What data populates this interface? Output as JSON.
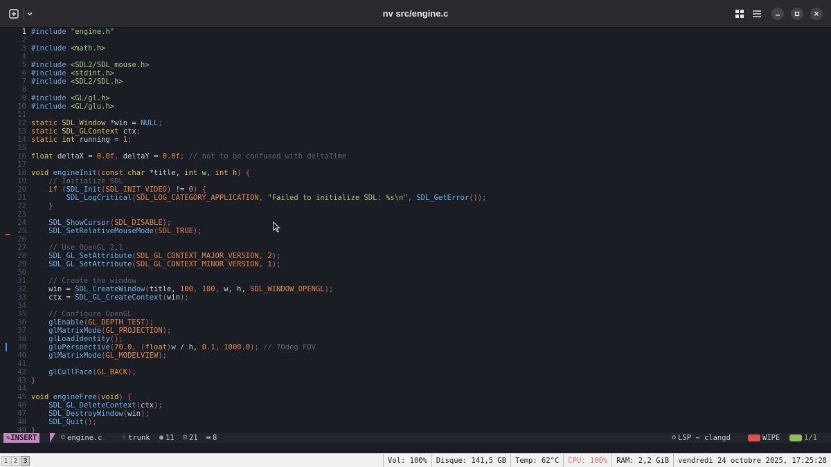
{
  "window": {
    "title": "nv src/engine.c"
  },
  "editor": {
    "lines": [
      {
        "n": "1",
        "segs": [
          [
            "pp",
            "#include "
          ],
          [
            "str",
            "\"engine.h\""
          ]
        ]
      },
      {
        "n": "2",
        "segs": []
      },
      {
        "n": "3",
        "segs": [
          [
            "pp",
            "#include "
          ],
          [
            "str",
            "<math.h>"
          ]
        ]
      },
      {
        "n": "4",
        "segs": []
      },
      {
        "n": "5",
        "segs": [
          [
            "pp",
            "#include "
          ],
          [
            "str",
            "<SDL2/SDL_mouse.h>"
          ]
        ]
      },
      {
        "n": "6",
        "segs": [
          [
            "pp",
            "#include "
          ],
          [
            "str",
            "<stdint.h>"
          ]
        ]
      },
      {
        "n": "7",
        "segs": [
          [
            "pp",
            "#include "
          ],
          [
            "str",
            "<SDL2/SDL.h>"
          ]
        ]
      },
      {
        "n": "8",
        "segs": []
      },
      {
        "n": "9",
        "segs": [
          [
            "pp",
            "#include "
          ],
          [
            "str",
            "<GL/gl.h>"
          ]
        ]
      },
      {
        "n": "10",
        "segs": [
          [
            "pp",
            "#include "
          ],
          [
            "str",
            "<GL/glu.h>"
          ]
        ]
      },
      {
        "n": "11",
        "segs": []
      },
      {
        "n": "12",
        "segs": [
          [
            "kw",
            "static "
          ],
          [
            "ty",
            "SDL_Window "
          ],
          [
            "op",
            "*win = "
          ],
          [
            "nul",
            "NULL"
          ],
          [
            "pun",
            ";"
          ]
        ]
      },
      {
        "n": "13",
        "segs": [
          [
            "kw",
            "static "
          ],
          [
            "ty",
            "SDL_GLContext "
          ],
          [
            "id",
            "ctx"
          ],
          [
            "pun",
            ";"
          ]
        ]
      },
      {
        "n": "14",
        "segs": [
          [
            "kw",
            "static "
          ],
          [
            "ty",
            "int "
          ],
          [
            "id",
            "running = "
          ],
          [
            "num",
            "1"
          ],
          [
            "pun",
            ";"
          ]
        ]
      },
      {
        "n": "15",
        "segs": []
      },
      {
        "n": "16",
        "segs": [
          [
            "ty",
            "float "
          ],
          [
            "id",
            "deltaX = "
          ],
          [
            "num",
            "0.0f"
          ],
          [
            "pun",
            ", "
          ],
          [
            "id",
            "deltaY = "
          ],
          [
            "num",
            "0.0f"
          ],
          [
            "pun",
            "; "
          ],
          [
            "cm",
            "// not to be confused with deltaTime"
          ]
        ]
      },
      {
        "n": "17",
        "segs": []
      },
      {
        "n": "18",
        "segs": [
          [
            "ty",
            "void "
          ],
          [
            "fn",
            "engineInit"
          ],
          [
            "pun",
            "("
          ],
          [
            "kw",
            "const "
          ],
          [
            "ty",
            "char "
          ],
          [
            "op",
            "*title, "
          ],
          [
            "ty",
            "int "
          ],
          [
            "id",
            "w, "
          ],
          [
            "ty",
            "int "
          ],
          [
            "id",
            "h"
          ],
          [
            "pun",
            ") {"
          ]
        ]
      },
      {
        "n": "19",
        "segs": [
          [
            "cm",
            "    // Initialize SDL"
          ]
        ]
      },
      {
        "n": "20",
        "segs": [
          [
            "kw",
            "    if "
          ],
          [
            "pun",
            "("
          ],
          [
            "fn",
            "SDL_Init"
          ],
          [
            "pun",
            "("
          ],
          [
            "mac",
            "SDL_INIT_VIDEO"
          ],
          [
            "pun",
            ") "
          ],
          [
            "op",
            "!= "
          ],
          [
            "num",
            "0"
          ],
          [
            "pun",
            ") {"
          ]
        ]
      },
      {
        "n": "21",
        "segs": [
          [
            "fn",
            "        SDL_LogCritical"
          ],
          [
            "pun",
            "("
          ],
          [
            "mac",
            "SDL_LOG_CATEGORY_APPLICATION"
          ],
          [
            "pun",
            ", "
          ],
          [
            "str",
            "\"Failed to initialize SDL: %s\\n\""
          ],
          [
            "pun",
            ", "
          ],
          [
            "fn",
            "SDL_GetError"
          ],
          [
            "pun",
            "());"
          ]
        ]
      },
      {
        "n": "22",
        "segs": [
          [
            "pun",
            "    }"
          ]
        ]
      },
      {
        "n": "23",
        "segs": []
      },
      {
        "n": "24",
        "segs": [
          [
            "fn",
            "    SDL_ShowCursor"
          ],
          [
            "pun",
            "("
          ],
          [
            "mac",
            "SDL_DISABLE"
          ],
          [
            "pun",
            ");"
          ]
        ]
      },
      {
        "n": "25",
        "segs": [
          [
            "fn",
            "    SDL_SetRelativeMouseMode"
          ],
          [
            "pun",
            "("
          ],
          [
            "mac",
            "SDL_TRUE"
          ],
          [
            "pun",
            ");"
          ]
        ],
        "sign": "red"
      },
      {
        "n": "26",
        "segs": []
      },
      {
        "n": "27",
        "segs": [
          [
            "cm",
            "    // Use OpenGL 2.1"
          ]
        ]
      },
      {
        "n": "28",
        "segs": [
          [
            "fn",
            "    SDL_GL_SetAttribute"
          ],
          [
            "pun",
            "("
          ],
          [
            "mac",
            "SDL_GL_CONTEXT_MAJOR_VERSION"
          ],
          [
            "pun",
            ", "
          ],
          [
            "num",
            "2"
          ],
          [
            "pun",
            ");"
          ]
        ]
      },
      {
        "n": "29",
        "segs": [
          [
            "fn",
            "    SDL_GL_SetAttribute"
          ],
          [
            "pun",
            "("
          ],
          [
            "mac",
            "SDL_GL_CONTEXT_MINOR_VERSION"
          ],
          [
            "pun",
            ", "
          ],
          [
            "num",
            "1"
          ],
          [
            "pun",
            ");"
          ]
        ]
      },
      {
        "n": "30",
        "segs": []
      },
      {
        "n": "31",
        "segs": [
          [
            "cm",
            "    // Create the window"
          ]
        ]
      },
      {
        "n": "32",
        "segs": [
          [
            "id",
            "    win = "
          ],
          [
            "fn",
            "SDL_CreateWindow"
          ],
          [
            "pun",
            "("
          ],
          [
            "id",
            "title, "
          ],
          [
            "num",
            "100"
          ],
          [
            "pun",
            ", "
          ],
          [
            "num",
            "100"
          ],
          [
            "pun",
            ", "
          ],
          [
            "id",
            "w, h, "
          ],
          [
            "mac",
            "SDL_WINDOW_OPENGL"
          ],
          [
            "pun",
            ");"
          ]
        ]
      },
      {
        "n": "33",
        "segs": [
          [
            "id",
            "    ctx = "
          ],
          [
            "fn",
            "SDL_GL_CreateContext"
          ],
          [
            "pun",
            "("
          ],
          [
            "id",
            "win"
          ],
          [
            "pun",
            ");"
          ]
        ]
      },
      {
        "n": "34",
        "segs": []
      },
      {
        "n": "35",
        "segs": [
          [
            "cm",
            "    // Configure OpenGL"
          ]
        ]
      },
      {
        "n": "36",
        "segs": [
          [
            "fn",
            "    glEnable"
          ],
          [
            "pun",
            "("
          ],
          [
            "mac",
            "GL_DEPTH_TEST"
          ],
          [
            "pun",
            ");"
          ]
        ]
      },
      {
        "n": "37",
        "segs": [
          [
            "fn",
            "    glMatrixMode"
          ],
          [
            "pun",
            "("
          ],
          [
            "mac",
            "GL_PROJECTION"
          ],
          [
            "pun",
            ");"
          ]
        ]
      },
      {
        "n": "38",
        "segs": [
          [
            "fn",
            "    glLoadIdentity"
          ],
          [
            "pun",
            "();"
          ]
        ]
      },
      {
        "n": "39",
        "segs": [
          [
            "fn",
            "    gluPerspective"
          ],
          [
            "pun",
            "("
          ],
          [
            "num",
            "70.0"
          ],
          [
            "pun",
            ", ("
          ],
          [
            "kw",
            "float"
          ],
          [
            "pun",
            ")"
          ],
          [
            "id",
            "w / h, "
          ],
          [
            "num",
            "0.1"
          ],
          [
            "pun",
            ", "
          ],
          [
            "num",
            "1000.0"
          ],
          [
            "pun",
            "); "
          ],
          [
            "cm",
            "// 70deg FOV"
          ]
        ],
        "sign": "blue"
      },
      {
        "n": "40",
        "segs": [
          [
            "fn",
            "    glMatrixMode"
          ],
          [
            "pun",
            "("
          ],
          [
            "mac",
            "GL_MODELVIEW"
          ],
          [
            "pun",
            ");"
          ]
        ]
      },
      {
        "n": "41",
        "segs": []
      },
      {
        "n": "42",
        "segs": [
          [
            "fn",
            "    glCullFace"
          ],
          [
            "pun",
            "("
          ],
          [
            "mac",
            "GL_BACK"
          ],
          [
            "pun",
            ");"
          ]
        ]
      },
      {
        "n": "43",
        "segs": [
          [
            "pun",
            "}"
          ]
        ]
      },
      {
        "n": "44",
        "segs": []
      },
      {
        "n": "45",
        "segs": [
          [
            "ty",
            "void "
          ],
          [
            "fn",
            "engineFree"
          ],
          [
            "pun",
            "("
          ],
          [
            "ty",
            "void"
          ],
          [
            "pun",
            ") {"
          ]
        ]
      },
      {
        "n": "46",
        "segs": [
          [
            "fn",
            "    SDL_GL_DeleteContext"
          ],
          [
            "pun",
            "("
          ],
          [
            "id",
            "ctx"
          ],
          [
            "pun",
            ");"
          ]
        ]
      },
      {
        "n": "47",
        "segs": [
          [
            "fn",
            "    SDL_DestroyWindow"
          ],
          [
            "pun",
            "("
          ],
          [
            "id",
            "win"
          ],
          [
            "pun",
            ");"
          ]
        ]
      },
      {
        "n": "48",
        "segs": [
          [
            "fn",
            "    SDL_Quit"
          ],
          [
            "pun",
            "();"
          ]
        ]
      },
      {
        "n": "49",
        "segs": [
          [
            "pun",
            "}"
          ]
        ]
      }
    ],
    "current_line": "1"
  },
  "statusline": {
    "mode": "INSERT",
    "file": "engine.c",
    "branch": "trunk",
    "errors": "11",
    "warnings": "21",
    "hints": "8",
    "lsp": "LSP ~ clangd",
    "wipe": "WIPE",
    "position": "1/1"
  },
  "bottombar": {
    "workspaces": [
      "1",
      "2",
      "3"
    ],
    "active_workspace": "3",
    "volume": "Vol: 100%",
    "disk": "Disque: 141,5 GB",
    "temp": "Temp: 62°C",
    "cpu": "CPU: 100%",
    "ram": "RAM: 2,2 GiB",
    "datetime": "vendredi 24 octobre 2025, 17:25:28"
  },
  "colors": {
    "background": "#1b1d24",
    "mode_insert": "#c586c0",
    "cpu_alert": "#e07070",
    "diag_error": "#d9534f",
    "position_accent": "#8fbf5a"
  }
}
